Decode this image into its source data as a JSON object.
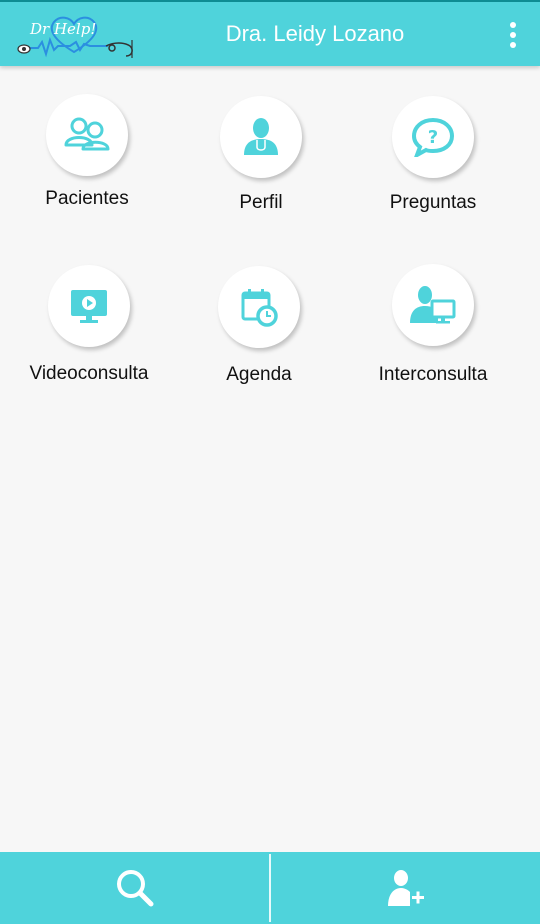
{
  "header": {
    "logo_text": "Dr Help!",
    "title": "Dra. Leidy Lozano",
    "menu_icon": "overflow-menu-icon"
  },
  "menu_items": [
    {
      "label": "Pacientes",
      "icon": "patients-icon"
    },
    {
      "label": "Perfil",
      "icon": "doctor-profile-icon"
    },
    {
      "label": "Preguntas",
      "icon": "question-bubble-icon"
    },
    {
      "label": "Videoconsulta",
      "icon": "video-monitor-icon"
    },
    {
      "label": "Agenda",
      "icon": "calendar-clock-icon"
    },
    {
      "label": "Interconsulta",
      "icon": "doctor-computer-icon"
    }
  ],
  "bottom_bar": {
    "left_icon": "search-icon",
    "right_icon": "add-user-icon"
  },
  "colors": {
    "accent": "#4fd3db",
    "background": "#f7f7f7"
  }
}
